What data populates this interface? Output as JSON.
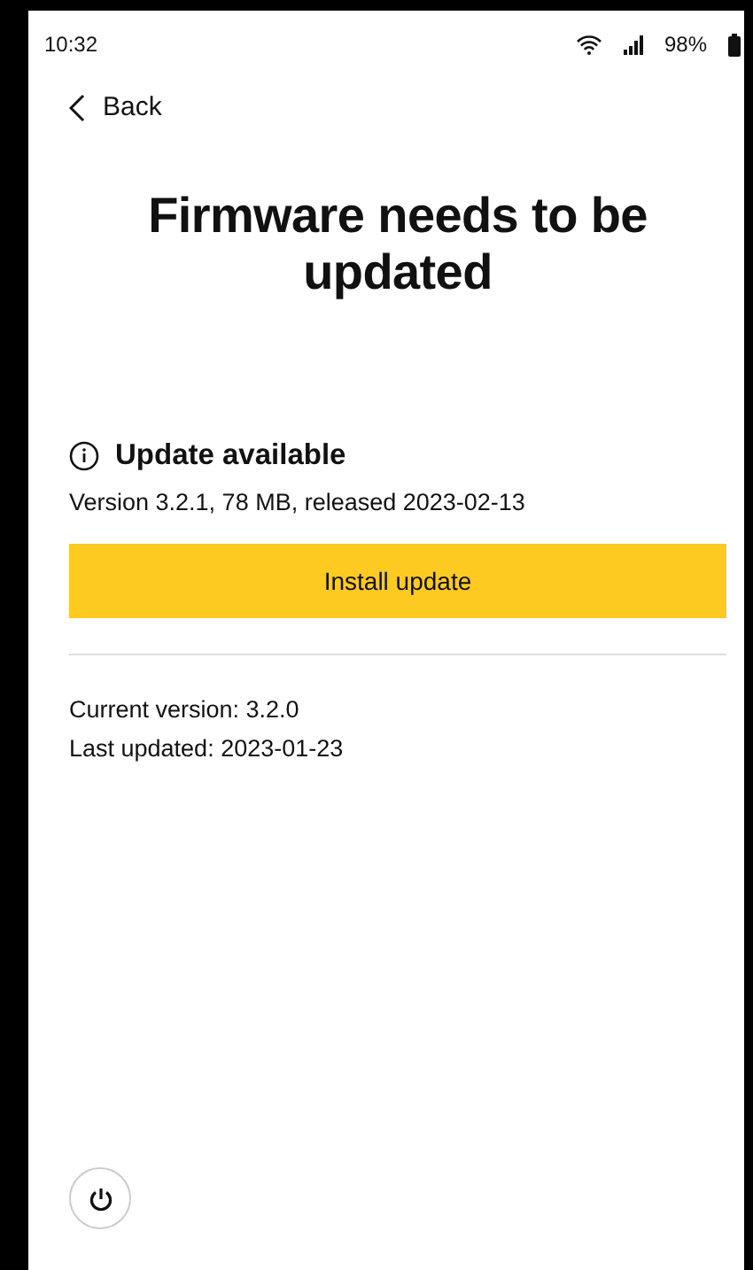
{
  "status_bar": {
    "time": "10:32",
    "battery": "98%"
  },
  "back": {
    "label": "Back"
  },
  "title": "Firmware needs to be updated",
  "update": {
    "heading": "Update available",
    "details": "Version 3.2.1, 78 MB, released 2023-02-13",
    "button": "Install update"
  },
  "current": {
    "version": "Current version: 3.2.0",
    "last_updated": "Last updated: 2023-01-23"
  }
}
